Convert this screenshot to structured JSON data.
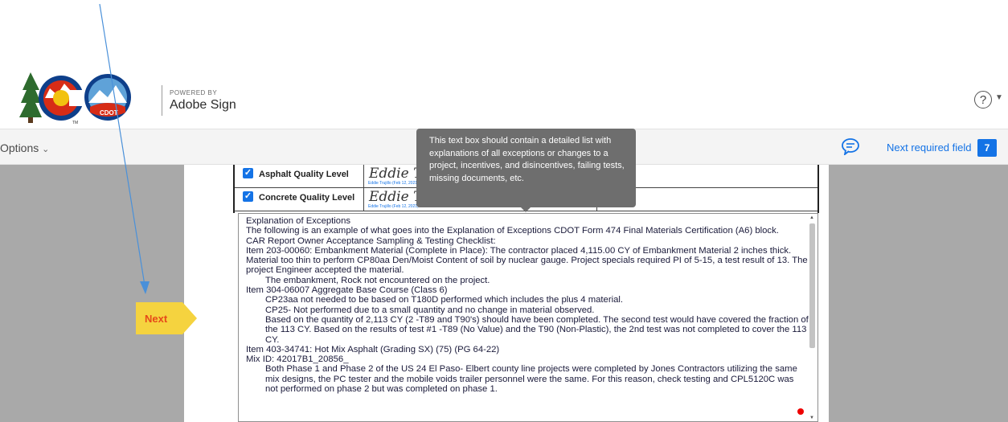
{
  "header": {
    "powered_by": "POWERED BY",
    "brand": "Adobe Sign",
    "help_icon": "question-circle-icon",
    "cdot_text": "CDOT",
    "tm_text": "TM"
  },
  "toolbar": {
    "options_label": "Options",
    "options_icon": "chevron-down-icon",
    "comment_icon": "speech-bubble-icon",
    "next_required_label": "Next required field",
    "next_required_count": "7"
  },
  "form": {
    "rows": [
      {
        "label": "Asphalt Quality Level",
        "checked": true,
        "signature": "Eddie Tr",
        "sig_sub": "Eddie Trujillo (Feb 12, 2021)"
      },
      {
        "label": "Concrete Quality Level",
        "checked": true,
        "signature": "Eddie Tr",
        "sig_sub": "Eddie Trujillo (Feb 12, 2021)"
      }
    ]
  },
  "tooltip": {
    "text": "This text box should contain a detailed list with explanations of all exceptions or changes to a project, incentives, and disincentives, failing tests, missing documents, etc."
  },
  "textbox": {
    "lines": [
      {
        "text": "Explanation of Exceptions",
        "indent": false
      },
      {
        "text": "The following is an example of what goes into the Explanation of Exceptions CDOT Form 474 Final Materials Certification (A6) block.",
        "indent": false
      },
      {
        "text": "CAR Report Owner Acceptance Sampling & Testing Checklist:",
        "indent": false
      },
      {
        "text": "Item 203-00060: Embankment Material (Complete in Place): The contractor placed 4,115.00 CY of Embankment Material 2 inches thick. Material too thin to perform CP80aa Den/Moist Content of soil by nuclear gauge.  Project specials required PI of 5-15, a test result of 13.  The project Engineer accepted the material.",
        "indent": false
      },
      {
        "text": "The embankment, Rock not encountered on the project.",
        "indent": true
      },
      {
        "text": "Item 304-06007 Aggregate Base Course (Class 6)",
        "indent": false
      },
      {
        "text": "CP23aa not needed to be based on T180D performed which includes the plus 4 material.",
        "indent": true
      },
      {
        "text": "CP25- Not performed due to a small quantity and no change in material observed.",
        "indent": true
      },
      {
        "text": "Based on the quantity of 2,113 CY (2 -T89 and T90's) should have been completed. The second test would have covered the fraction of the 113 CY. Based on the results of test #1 -T89 (No Value) and the T90 (Non-Plastic), the 2nd test was not completed to cover the 113 CY.",
        "indent": true
      },
      {
        "text": "Item 403-34741:  Hot Mix Asphalt (Grading SX) (75) (PG 64-22)",
        "indent": false
      },
      {
        "text": "Mix ID: 42017B1_20856_",
        "indent": false
      },
      {
        "text": "Both Phase 1 and Phase 2 of the US 24 El Paso- Elbert county line projects were completed by Jones Contractors utilizing the same mix designs, the PC tester and the mobile voids trailer personnel were the same.  For this reason, check testing and CPL5120C was not performed on phase 2 but was completed on phase 1.",
        "indent": true
      }
    ]
  },
  "next_tag": {
    "label": "Next",
    "color": "#f5d33f",
    "icon": "arrow-tag-icon"
  },
  "colors": {
    "accent": "#1473e6",
    "canvas": "#a9a9a9",
    "tooltip": "#6e6e6e"
  }
}
